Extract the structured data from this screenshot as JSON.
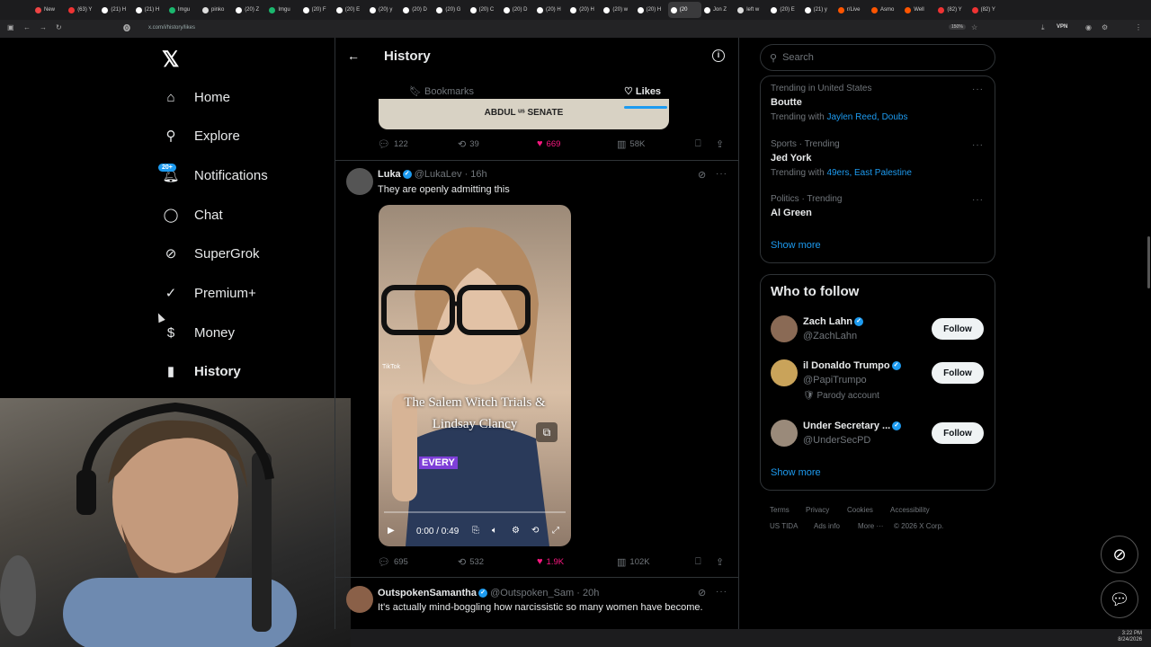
{
  "browser": {
    "tabs": [
      {
        "label": "New",
        "color": "#e44"
      },
      {
        "label": "(63) Y",
        "color": "#e33"
      },
      {
        "label": "(21) H",
        "color": "#fff"
      },
      {
        "label": "(21) H",
        "color": "#fff"
      },
      {
        "label": "Imgu",
        "color": "#1bb76e"
      },
      {
        "label": "pinko",
        "color": "#ddd"
      },
      {
        "label": "(20) Z",
        "color": "#fff"
      },
      {
        "label": "Imgu",
        "color": "#1bb76e"
      },
      {
        "label": "(20) F",
        "color": "#fff"
      },
      {
        "label": "(20) E",
        "color": "#fff"
      },
      {
        "label": "(20) y",
        "color": "#fff"
      },
      {
        "label": "(20) D",
        "color": "#fff"
      },
      {
        "label": "(20) G",
        "color": "#fff"
      },
      {
        "label": "(20) C",
        "color": "#fff"
      },
      {
        "label": "(20) D",
        "color": "#fff"
      },
      {
        "label": "(20) H",
        "color": "#fff"
      },
      {
        "label": "(20) H",
        "color": "#fff"
      },
      {
        "label": "(20) w",
        "color": "#fff"
      },
      {
        "label": "(20) H",
        "color": "#fff"
      },
      {
        "label": "(20",
        "color": "#fff",
        "active": true
      },
      {
        "label": "Jon Z",
        "color": "#fff"
      },
      {
        "label": "left w",
        "color": "#ddd"
      },
      {
        "label": "(20) E",
        "color": "#fff"
      },
      {
        "label": "(21) y",
        "color": "#fff"
      },
      {
        "label": "r/Live",
        "color": "#f50"
      },
      {
        "label": "Asmo",
        "color": "#f50"
      },
      {
        "label": "Well",
        "color": "#f50"
      },
      {
        "label": "(82) Y",
        "color": "#e33"
      },
      {
        "label": "(82) Y",
        "color": "#e33"
      }
    ],
    "url": "x.com/i/history/likes",
    "zoom": "150%",
    "vpn": "VPN"
  },
  "nav": {
    "logo": "𝕏",
    "items": [
      {
        "label": "Home",
        "icon": "⌂"
      },
      {
        "label": "Explore",
        "icon": "⚲"
      },
      {
        "label": "Notifications",
        "icon": "🔔︎",
        "badge": "20+"
      },
      {
        "label": "Chat",
        "icon": "◯"
      },
      {
        "label": "SuperGrok",
        "icon": "⊘"
      },
      {
        "label": "Premium+",
        "icon": "✓"
      },
      {
        "label": "Money",
        "icon": "$"
      },
      {
        "label": "History",
        "icon": "▮",
        "active": true
      }
    ]
  },
  "header": {
    "title": "History",
    "tabs": [
      "Bookmarks",
      "Likes"
    ],
    "active_tab": "Likes"
  },
  "prev_post": {
    "media_text": "ABDUL ᵘˢ SENATE",
    "replies": "122",
    "reposts": "39",
    "likes": "669",
    "views": "58K"
  },
  "post1": {
    "name": "Luka",
    "handle": "@LukaLev",
    "time": "16h",
    "text": "They are openly admitting this",
    "video": {
      "watermark": "TikTok",
      "caption_line1": "The Salem Witch Trials &",
      "caption_line2": "Lindsay Clancy",
      "subtitle": "EVERY",
      "time": "0:00 / 0:49",
      "progress": 0
    },
    "replies": "695",
    "reposts": "532",
    "likes": "1.9K",
    "views": "102K"
  },
  "post2": {
    "name": "OutspokenSamantha",
    "handle": "@Outspoken_Sam",
    "time": "20h",
    "text": "It's actually mind-boggling how narcissistic so many women have become."
  },
  "search": {
    "placeholder": "Search"
  },
  "trends": [
    {
      "context": "Trending in United States",
      "name": "Boutte",
      "with_prefix": "Trending with ",
      "with": "Jaylen Reed, Doubs"
    },
    {
      "context": "Sports · Trending",
      "name": "Jed York",
      "with_prefix": "Trending with ",
      "with": "49ers, East Palestine"
    },
    {
      "context": "Politics · Trending",
      "name": "Al Green",
      "with_prefix": "",
      "with": ""
    }
  ],
  "show_more": "Show more",
  "who_to_follow": {
    "title": "Who to follow",
    "users": [
      {
        "name": "Zach Lahn",
        "handle": "@ZachLahn",
        "color": "#8a6a55"
      },
      {
        "name": "il Donaldo Trumpo",
        "handle": "@PapiTrumpo",
        "note": "🛡 Parody account",
        "color": "#c9a35a"
      },
      {
        "name": "Under Secretary ...",
        "handle": "@UnderSecPD",
        "color": "#9a8a7a"
      }
    ],
    "follow_label": "Follow"
  },
  "footer": {
    "links": [
      "Terms",
      "Privacy",
      "Cookies",
      "Accessibility",
      "US TIDA",
      "Ads info",
      "More ···",
      "© 2026 X Corp."
    ]
  },
  "taskbar": {
    "time": "3:22 PM",
    "date": "8/24/2026"
  }
}
